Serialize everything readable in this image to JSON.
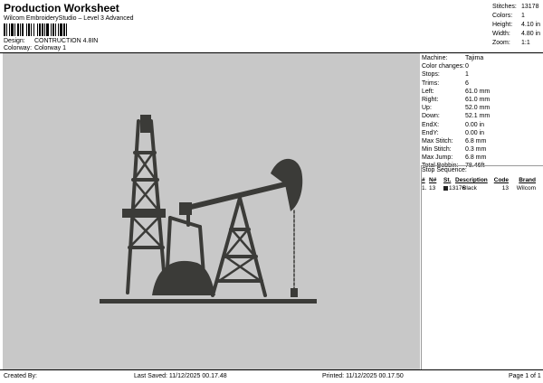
{
  "header": {
    "title": "Production Worksheet",
    "subtitle": "Wilcom EmbroideryStudio – Level 3 Advanced",
    "design_label": "Design:",
    "design_value": "CONTRUCTION 4.8IN",
    "colorway_label": "Colorway:",
    "colorway_value": "Colorway 1"
  },
  "stats": [
    {
      "k": "Stitches:",
      "v": "13178"
    },
    {
      "k": "Colors:",
      "v": "1"
    },
    {
      "k": "Height:",
      "v": "4.10 in"
    },
    {
      "k": "Width:",
      "v": "4.80 in"
    },
    {
      "k": "Zoom:",
      "v": "1:1"
    }
  ],
  "info": [
    {
      "k": "Machine:",
      "v": "Tajima"
    },
    {
      "k": "Color changes:",
      "v": "0"
    },
    {
      "k": "Stops:",
      "v": "1"
    },
    {
      "k": "Trims:",
      "v": "6"
    },
    {
      "k": "Left:",
      "v": "61.0 mm"
    },
    {
      "k": "Right:",
      "v": "61.0 mm"
    },
    {
      "k": "Up:",
      "v": "52.0 mm"
    },
    {
      "k": "Down:",
      "v": "52.1 mm"
    },
    {
      "k": "EndX:",
      "v": "0.00 in"
    },
    {
      "k": "EndY:",
      "v": "0.00 in"
    },
    {
      "k": "Max Stitch:",
      "v": "6.8 mm"
    },
    {
      "k": "Min Stitch:",
      "v": "0.3 mm"
    },
    {
      "k": "Max Jump:",
      "v": "6.8 mm"
    },
    {
      "k": "Total Bobbin:",
      "v": "78.46ft"
    }
  ],
  "sequence": {
    "title": "Stop Sequence:",
    "headers": [
      "#",
      "N#",
      "St.",
      "Description",
      "Code",
      "Brand"
    ],
    "rows": [
      {
        "idx": "1.",
        "n": "13",
        "st": "13176",
        "desc": "Black",
        "code": "13",
        "brand": "Wilcom"
      }
    ]
  },
  "footer": {
    "created": "Created By:",
    "saved": "Last Saved: 11/12/2025 00.17.48",
    "printed": "Printed: 11/12/2025 00.17.50",
    "page": "Page 1 of 1"
  },
  "colors": {
    "canvas": "#c8c8c8",
    "thread": "#3b3b38"
  }
}
